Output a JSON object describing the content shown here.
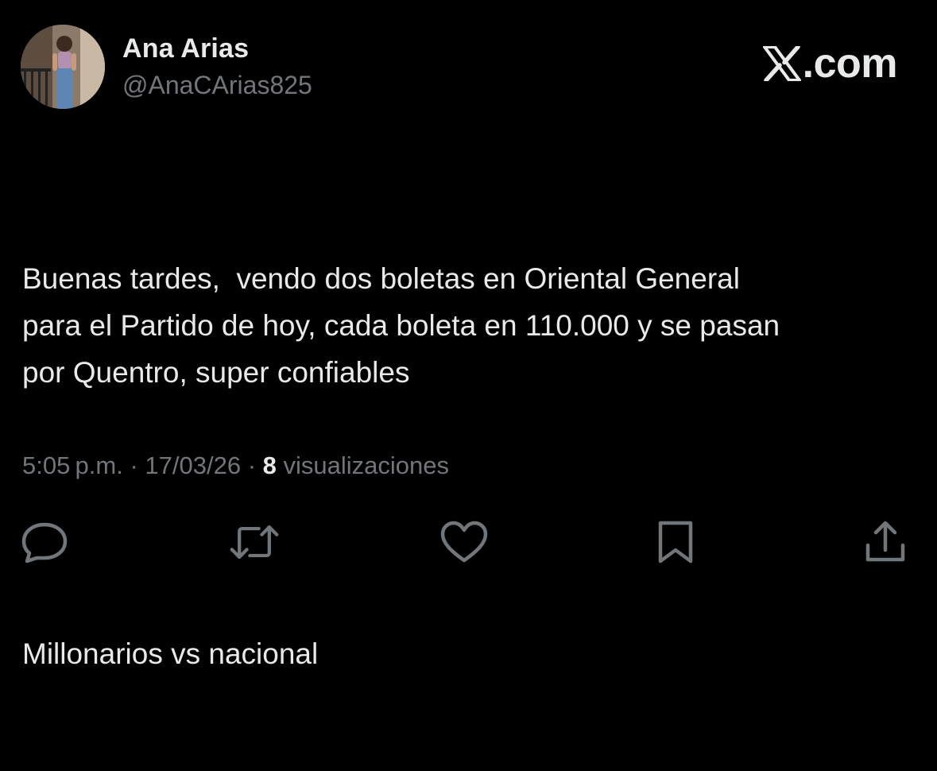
{
  "author": {
    "display_name": "Ana Arias",
    "handle": "@AnaCArias825",
    "avatar_icon": "profile-photo"
  },
  "brand": {
    "text": ".com",
    "logo_icon": "x-logo-icon"
  },
  "tweet": {
    "paragraphs": [
      "Buenas tardes,  vendo dos boletas en Oriental General\npara el Partido de hoy, cada boleta en 110.000 y se pasan\npor Quentro, super confiables",
      "Millonarios vs nacional"
    ]
  },
  "meta": {
    "time": "5:05 p.m.",
    "separator": " · ",
    "date": "17/03/26",
    "views_count": "8",
    "views_label": " visualizaciones"
  },
  "actions": [
    {
      "name": "reply",
      "icon": "reply-icon"
    },
    {
      "name": "retweet",
      "icon": "retweet-icon"
    },
    {
      "name": "like",
      "icon": "heart-icon"
    },
    {
      "name": "bookmark",
      "icon": "bookmark-icon"
    },
    {
      "name": "share",
      "icon": "share-icon"
    }
  ],
  "colors": {
    "background": "#000000",
    "primary_text": "#e7e9ea",
    "secondary_text": "#71767b"
  }
}
